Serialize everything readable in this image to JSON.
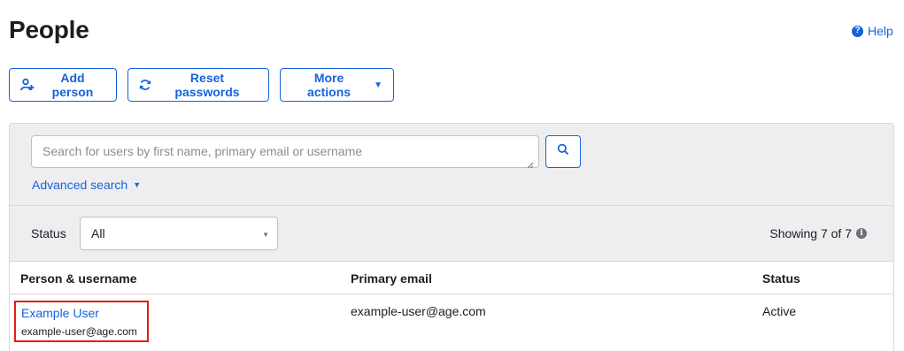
{
  "page": {
    "title": "People"
  },
  "help": {
    "label": "Help",
    "icon": "question-circle-icon"
  },
  "toolbar": {
    "add_label": "Add person",
    "reset_label": "Reset passwords",
    "more_label": "More actions"
  },
  "search": {
    "placeholder": "Search for users by first name, primary email or username",
    "advanced_label": "Advanced search"
  },
  "filter": {
    "status_label": "Status",
    "status_value": "All",
    "showing": "Showing 7 of 7"
  },
  "table": {
    "headers": [
      "Person & username",
      "Primary email",
      "Status"
    ],
    "rows": [
      {
        "name": "Example User",
        "username": "example-user@age.com",
        "email": "example-user@age.com",
        "status": "Active"
      }
    ]
  },
  "colors": {
    "accent": "#1662dd",
    "highlight": "#e11d1d",
    "panel_bg": "#eeeef1"
  }
}
